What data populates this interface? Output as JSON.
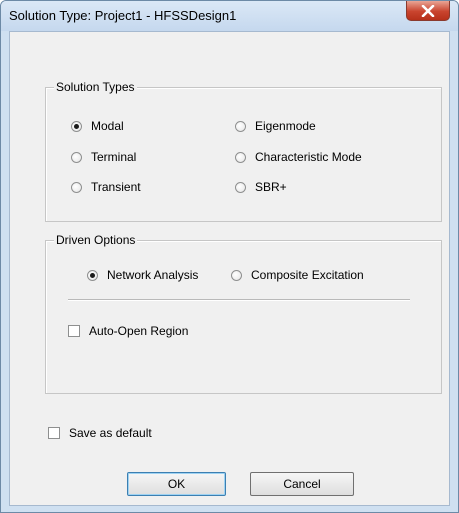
{
  "window": {
    "title": "Solution Type: Project1 - HFSSDesign1"
  },
  "solution_types": {
    "label": "Solution Types",
    "options": [
      {
        "label": "Modal",
        "selected": true
      },
      {
        "label": "Terminal",
        "selected": false
      },
      {
        "label": "Transient",
        "selected": false
      },
      {
        "label": "Eigenmode",
        "selected": false
      },
      {
        "label": "Characteristic Mode",
        "selected": false
      },
      {
        "label": "SBR+",
        "selected": false
      }
    ]
  },
  "driven_options": {
    "label": "Driven Options",
    "options": [
      {
        "label": "Network Analysis",
        "selected": true
      },
      {
        "label": "Composite Excitation",
        "selected": false
      }
    ],
    "auto_open_region": {
      "label": "Auto-Open Region",
      "checked": false
    }
  },
  "save_default": {
    "label": "Save as default",
    "checked": false
  },
  "buttons": {
    "ok": "OK",
    "cancel": "Cancel"
  }
}
